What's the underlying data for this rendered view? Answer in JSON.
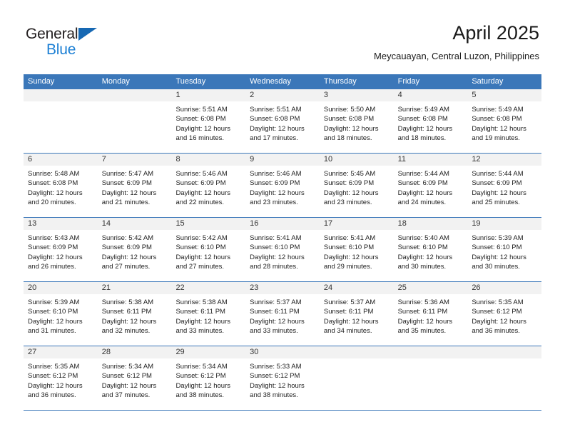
{
  "logo": {
    "word_one": "General",
    "word_two": "Blue",
    "triangle_color": "#1668b3",
    "blue_color": "#1b7fd4"
  },
  "header": {
    "title": "April 2025",
    "subtitle": "Meycauayan, Central Luzon, Philippines"
  },
  "theme": {
    "header_blue": "#3b77b9",
    "day_strip_gray": "#f2f2f2",
    "text_color": "#222222"
  },
  "calendar": {
    "weekdays": [
      "Sunday",
      "Monday",
      "Tuesday",
      "Wednesday",
      "Thursday",
      "Friday",
      "Saturday"
    ],
    "weeks": [
      [
        {
          "day": "",
          "sunrise": "",
          "sunset": "",
          "daylight_line1": "",
          "daylight_line2": ""
        },
        {
          "day": "",
          "sunrise": "",
          "sunset": "",
          "daylight_line1": "",
          "daylight_line2": ""
        },
        {
          "day": "1",
          "sunrise": "Sunrise: 5:51 AM",
          "sunset": "Sunset: 6:08 PM",
          "daylight_line1": "Daylight: 12 hours",
          "daylight_line2": "and 16 minutes."
        },
        {
          "day": "2",
          "sunrise": "Sunrise: 5:51 AM",
          "sunset": "Sunset: 6:08 PM",
          "daylight_line1": "Daylight: 12 hours",
          "daylight_line2": "and 17 minutes."
        },
        {
          "day": "3",
          "sunrise": "Sunrise: 5:50 AM",
          "sunset": "Sunset: 6:08 PM",
          "daylight_line1": "Daylight: 12 hours",
          "daylight_line2": "and 18 minutes."
        },
        {
          "day": "4",
          "sunrise": "Sunrise: 5:49 AM",
          "sunset": "Sunset: 6:08 PM",
          "daylight_line1": "Daylight: 12 hours",
          "daylight_line2": "and 18 minutes."
        },
        {
          "day": "5",
          "sunrise": "Sunrise: 5:49 AM",
          "sunset": "Sunset: 6:08 PM",
          "daylight_line1": "Daylight: 12 hours",
          "daylight_line2": "and 19 minutes."
        }
      ],
      [
        {
          "day": "6",
          "sunrise": "Sunrise: 5:48 AM",
          "sunset": "Sunset: 6:08 PM",
          "daylight_line1": "Daylight: 12 hours",
          "daylight_line2": "and 20 minutes."
        },
        {
          "day": "7",
          "sunrise": "Sunrise: 5:47 AM",
          "sunset": "Sunset: 6:09 PM",
          "daylight_line1": "Daylight: 12 hours",
          "daylight_line2": "and 21 minutes."
        },
        {
          "day": "8",
          "sunrise": "Sunrise: 5:46 AM",
          "sunset": "Sunset: 6:09 PM",
          "daylight_line1": "Daylight: 12 hours",
          "daylight_line2": "and 22 minutes."
        },
        {
          "day": "9",
          "sunrise": "Sunrise: 5:46 AM",
          "sunset": "Sunset: 6:09 PM",
          "daylight_line1": "Daylight: 12 hours",
          "daylight_line2": "and 23 minutes."
        },
        {
          "day": "10",
          "sunrise": "Sunrise: 5:45 AM",
          "sunset": "Sunset: 6:09 PM",
          "daylight_line1": "Daylight: 12 hours",
          "daylight_line2": "and 23 minutes."
        },
        {
          "day": "11",
          "sunrise": "Sunrise: 5:44 AM",
          "sunset": "Sunset: 6:09 PM",
          "daylight_line1": "Daylight: 12 hours",
          "daylight_line2": "and 24 minutes."
        },
        {
          "day": "12",
          "sunrise": "Sunrise: 5:44 AM",
          "sunset": "Sunset: 6:09 PM",
          "daylight_line1": "Daylight: 12 hours",
          "daylight_line2": "and 25 minutes."
        }
      ],
      [
        {
          "day": "13",
          "sunrise": "Sunrise: 5:43 AM",
          "sunset": "Sunset: 6:09 PM",
          "daylight_line1": "Daylight: 12 hours",
          "daylight_line2": "and 26 minutes."
        },
        {
          "day": "14",
          "sunrise": "Sunrise: 5:42 AM",
          "sunset": "Sunset: 6:09 PM",
          "daylight_line1": "Daylight: 12 hours",
          "daylight_line2": "and 27 minutes."
        },
        {
          "day": "15",
          "sunrise": "Sunrise: 5:42 AM",
          "sunset": "Sunset: 6:10 PM",
          "daylight_line1": "Daylight: 12 hours",
          "daylight_line2": "and 27 minutes."
        },
        {
          "day": "16",
          "sunrise": "Sunrise: 5:41 AM",
          "sunset": "Sunset: 6:10 PM",
          "daylight_line1": "Daylight: 12 hours",
          "daylight_line2": "and 28 minutes."
        },
        {
          "day": "17",
          "sunrise": "Sunrise: 5:41 AM",
          "sunset": "Sunset: 6:10 PM",
          "daylight_line1": "Daylight: 12 hours",
          "daylight_line2": "and 29 minutes."
        },
        {
          "day": "18",
          "sunrise": "Sunrise: 5:40 AM",
          "sunset": "Sunset: 6:10 PM",
          "daylight_line1": "Daylight: 12 hours",
          "daylight_line2": "and 30 minutes."
        },
        {
          "day": "19",
          "sunrise": "Sunrise: 5:39 AM",
          "sunset": "Sunset: 6:10 PM",
          "daylight_line1": "Daylight: 12 hours",
          "daylight_line2": "and 30 minutes."
        }
      ],
      [
        {
          "day": "20",
          "sunrise": "Sunrise: 5:39 AM",
          "sunset": "Sunset: 6:10 PM",
          "daylight_line1": "Daylight: 12 hours",
          "daylight_line2": "and 31 minutes."
        },
        {
          "day": "21",
          "sunrise": "Sunrise: 5:38 AM",
          "sunset": "Sunset: 6:11 PM",
          "daylight_line1": "Daylight: 12 hours",
          "daylight_line2": "and 32 minutes."
        },
        {
          "day": "22",
          "sunrise": "Sunrise: 5:38 AM",
          "sunset": "Sunset: 6:11 PM",
          "daylight_line1": "Daylight: 12 hours",
          "daylight_line2": "and 33 minutes."
        },
        {
          "day": "23",
          "sunrise": "Sunrise: 5:37 AM",
          "sunset": "Sunset: 6:11 PM",
          "daylight_line1": "Daylight: 12 hours",
          "daylight_line2": "and 33 minutes."
        },
        {
          "day": "24",
          "sunrise": "Sunrise: 5:37 AM",
          "sunset": "Sunset: 6:11 PM",
          "daylight_line1": "Daylight: 12 hours",
          "daylight_line2": "and 34 minutes."
        },
        {
          "day": "25",
          "sunrise": "Sunrise: 5:36 AM",
          "sunset": "Sunset: 6:11 PM",
          "daylight_line1": "Daylight: 12 hours",
          "daylight_line2": "and 35 minutes."
        },
        {
          "day": "26",
          "sunrise": "Sunrise: 5:35 AM",
          "sunset": "Sunset: 6:12 PM",
          "daylight_line1": "Daylight: 12 hours",
          "daylight_line2": "and 36 minutes."
        }
      ],
      [
        {
          "day": "27",
          "sunrise": "Sunrise: 5:35 AM",
          "sunset": "Sunset: 6:12 PM",
          "daylight_line1": "Daylight: 12 hours",
          "daylight_line2": "and 36 minutes."
        },
        {
          "day": "28",
          "sunrise": "Sunrise: 5:34 AM",
          "sunset": "Sunset: 6:12 PM",
          "daylight_line1": "Daylight: 12 hours",
          "daylight_line2": "and 37 minutes."
        },
        {
          "day": "29",
          "sunrise": "Sunrise: 5:34 AM",
          "sunset": "Sunset: 6:12 PM",
          "daylight_line1": "Daylight: 12 hours",
          "daylight_line2": "and 38 minutes."
        },
        {
          "day": "30",
          "sunrise": "Sunrise: 5:33 AM",
          "sunset": "Sunset: 6:12 PM",
          "daylight_line1": "Daylight: 12 hours",
          "daylight_line2": "and 38 minutes."
        },
        {
          "day": "",
          "sunrise": "",
          "sunset": "",
          "daylight_line1": "",
          "daylight_line2": ""
        },
        {
          "day": "",
          "sunrise": "",
          "sunset": "",
          "daylight_line1": "",
          "daylight_line2": ""
        },
        {
          "day": "",
          "sunrise": "",
          "sunset": "",
          "daylight_line1": "",
          "daylight_line2": ""
        }
      ]
    ]
  }
}
